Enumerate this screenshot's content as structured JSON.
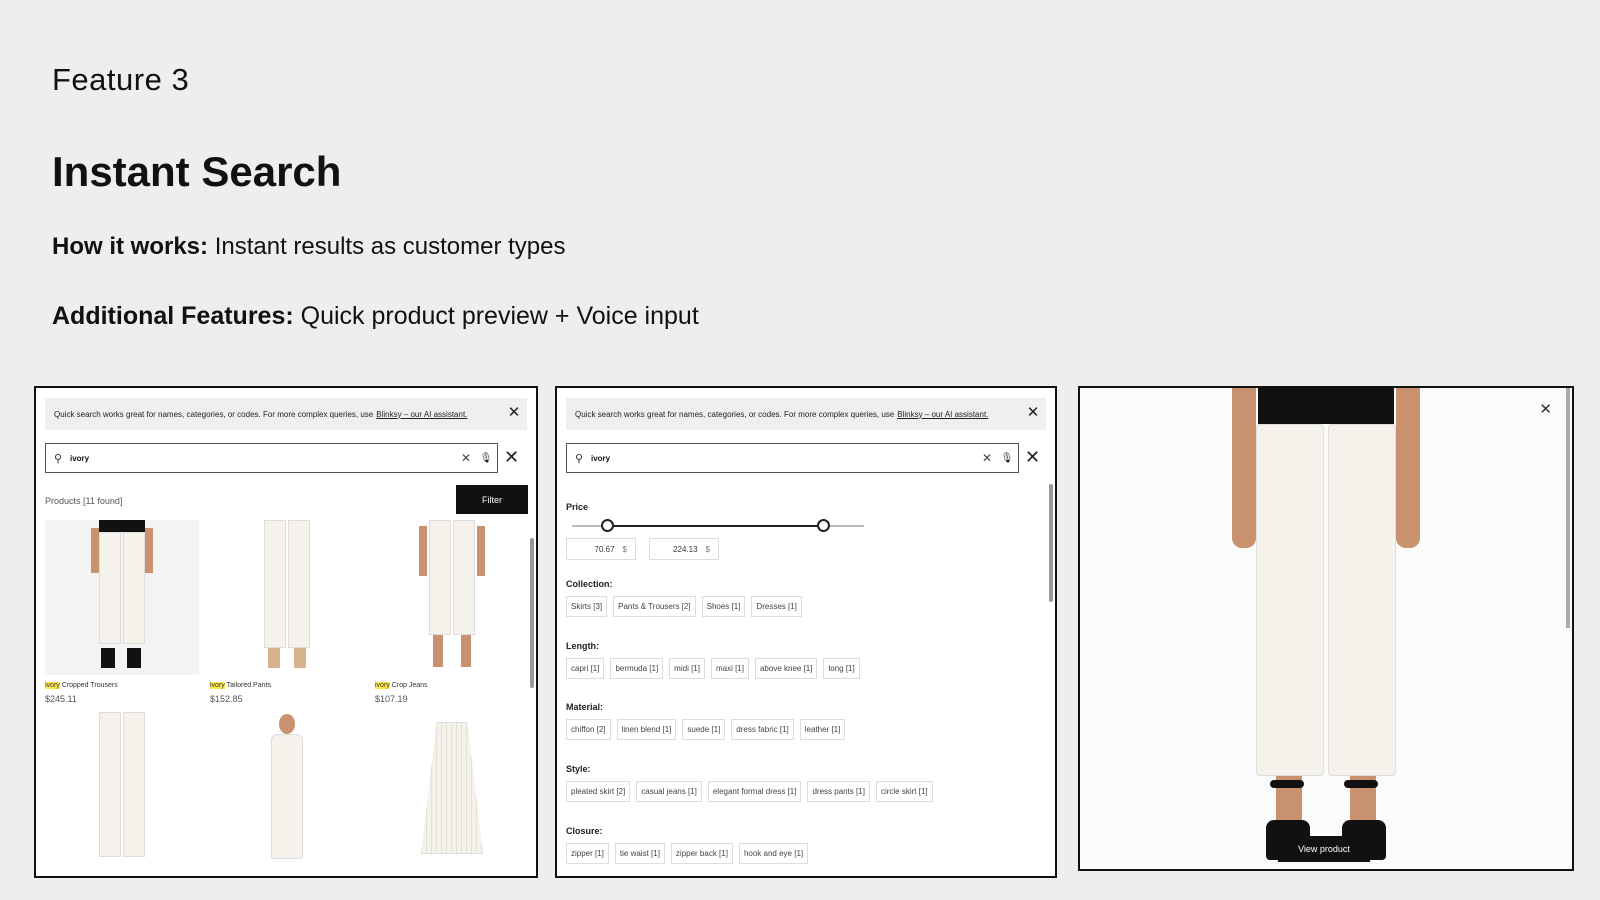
{
  "slide": {
    "eyebrow": "Feature 3",
    "headline": "Instant Search",
    "how_label": "How it works:",
    "how_text": "Instant results as customer types",
    "additional_label": "Additional Features:",
    "additional_text": "Quick product preview + Voice input"
  },
  "notice": {
    "text": "Quick search works great for names, categories, or codes. For more complex queries, use",
    "link": "Blinksy – our AI assistant."
  },
  "search": {
    "value": "ivory"
  },
  "results": {
    "found_label": "Products [11 found]",
    "filter_label": "Filter",
    "products": [
      {
        "highlight": "ivory",
        "rest": " Cropped Trousers",
        "price": "$245.11"
      },
      {
        "highlight": "ivory",
        "rest": " Tailored Pants",
        "price": "$152.85"
      },
      {
        "highlight": "ivory",
        "rest": " Crop Jeans",
        "price": "$107.19"
      }
    ]
  },
  "filters": {
    "price_title": "Price",
    "price_min": "70.67",
    "price_max": "224.13",
    "currency": "$",
    "price_range_fraction": [
      0.12,
      0.86
    ],
    "collection_title": "Collection:",
    "collection": [
      "Skirts [3]",
      "Pants & Trousers [2]",
      "Shoes [1]",
      "Dresses [1]"
    ],
    "length_title": "Length:",
    "length": [
      "capri [1]",
      "bermuda [1]",
      "midi [1]",
      "maxi [1]",
      "above knee [1]",
      "long [1]"
    ],
    "material_title": "Material:",
    "material": [
      "chiffon [2]",
      "linen blend [1]",
      "suede [1]",
      "dress fabric [1]",
      "leather [1]"
    ],
    "style_title": "Style:",
    "style": [
      "pleated skirt [2]",
      "casual jeans [1]",
      "elegant formal dress [1]",
      "dress pants [1]",
      "circle skirt [1]"
    ],
    "closure_title": "Closure:",
    "closure": [
      "zipper [1]",
      "tie waist [1]",
      "zipper back [1]",
      "hook and eye [1]"
    ]
  },
  "preview": {
    "view_label": "View product"
  }
}
